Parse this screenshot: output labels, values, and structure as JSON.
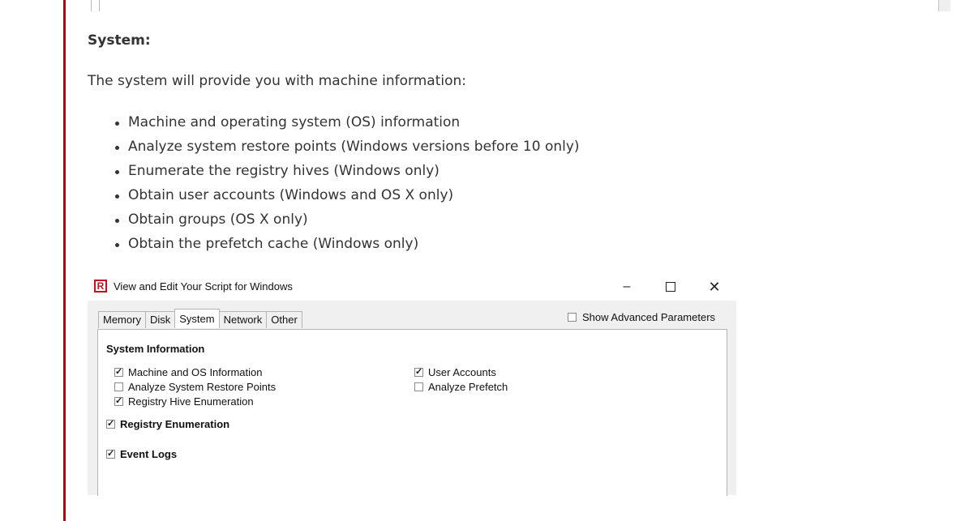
{
  "article": {
    "section_title": "System:",
    "intro": "The system will provide you with machine information:",
    "bullets": [
      "Machine and operating system (OS) information",
      "Analyze system restore points (Windows versions before 10 only)",
      "Enumerate the registry hives (Windows only)",
      "Obtain user accounts (Windows and OS X only)",
      "Obtain groups (OS X only)",
      "Obtain the prefetch cache (Windows only)"
    ]
  },
  "dialog": {
    "title": "View and Edit Your Script for Windows",
    "app_icon_glyph": "R",
    "buttons": {
      "minimize": "–",
      "close": "✕"
    },
    "tabs": [
      "Memory",
      "Disk",
      "System",
      "Network",
      "Other"
    ],
    "active_tab": "System",
    "show_advanced": {
      "label": "Show Advanced Parameters",
      "checked": false
    },
    "group_title": "System Information",
    "options_left": [
      {
        "label": "Machine and OS Information",
        "checked": true
      },
      {
        "label": "Analyze System Restore Points",
        "checked": false
      },
      {
        "label": "Registry Hive Enumeration",
        "checked": true
      }
    ],
    "options_right": [
      {
        "label": "User Accounts",
        "checked": true
      },
      {
        "label": "Analyze Prefetch",
        "checked": false
      }
    ],
    "registry_enumeration": {
      "label": "Registry Enumeration",
      "checked": true
    },
    "event_logs": {
      "label": "Event Logs",
      "checked": true
    }
  },
  "colors": {
    "accent_bar": "#a50d12",
    "app_icon": "#c1121f"
  }
}
